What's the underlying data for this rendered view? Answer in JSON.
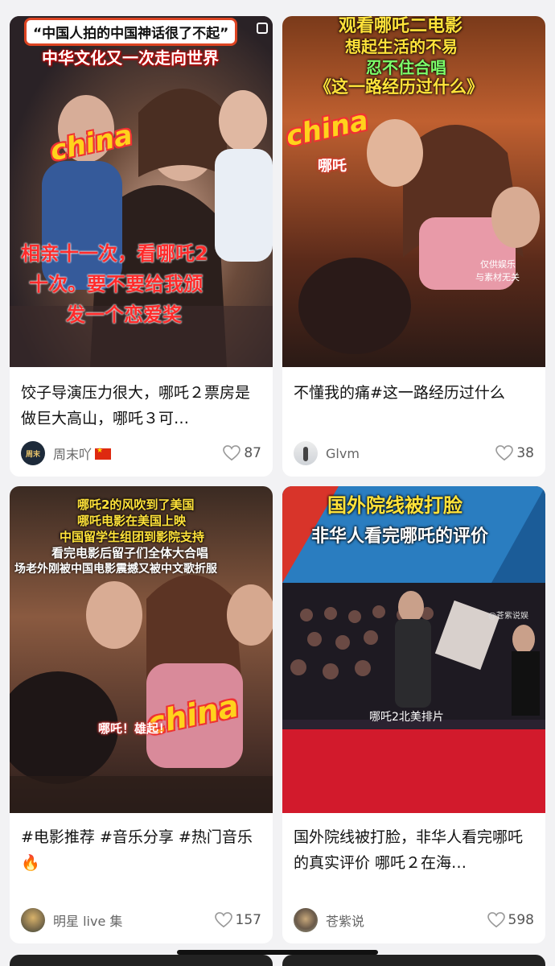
{
  "cards": [
    {
      "title": "饺子导演压力很大，哪吒２票房是做巨大高山，哪吒３可…",
      "author": "周末吖",
      "author_flag": "🇨🇳",
      "likes": "87",
      "overlay": {
        "banner": "“中国人拍的中国神话很了不起”",
        "subtitle": "中华文化又一次走向世界",
        "sticker": "china",
        "caption_lines": [
          "相亲十一次，看哪吒2",
          "十次。要不要给我颁",
          "发一个恋爱奖"
        ]
      }
    },
    {
      "title": "不懂我的痛#这一路经历过什么",
      "author": "Glvm",
      "likes": "38",
      "overlay": {
        "line1": "观看哪吒二电影",
        "line2": "想起生活的不易",
        "line3": "忍不住合唱",
        "line4": "《这一路经历过什么》",
        "sticker": "china",
        "sticker_sub": "哪吒",
        "watermark1": "仅供娱乐",
        "watermark2": "与素材无关"
      }
    },
    {
      "title": "#电影推荐 #音乐分享 #热门音乐🔥",
      "author": "明星 live 集",
      "likes": "157",
      "overlay": {
        "lines": [
          "哪吒2的风吹到了美国",
          "哪吒电影在美国上映",
          "中国留学生组团到影院支持",
          "看完电影后留子们全体大合唱",
          "场老外刚被中国电影震撼又被中文歌折服"
        ],
        "sticker": "china",
        "sticker_sub": "哪吒！雄起！"
      }
    },
    {
      "title": "国外院线被打脸，非华人看完哪吒的真实评价 哪吒２在海…",
      "author": "苍紫说",
      "likes": "598",
      "overlay": {
        "line1": "国外院线被打脸",
        "line2": "非华人看完哪吒的评价",
        "watermark": "@苍紫说娱",
        "caption": "哪吒2北美排片"
      }
    }
  ]
}
